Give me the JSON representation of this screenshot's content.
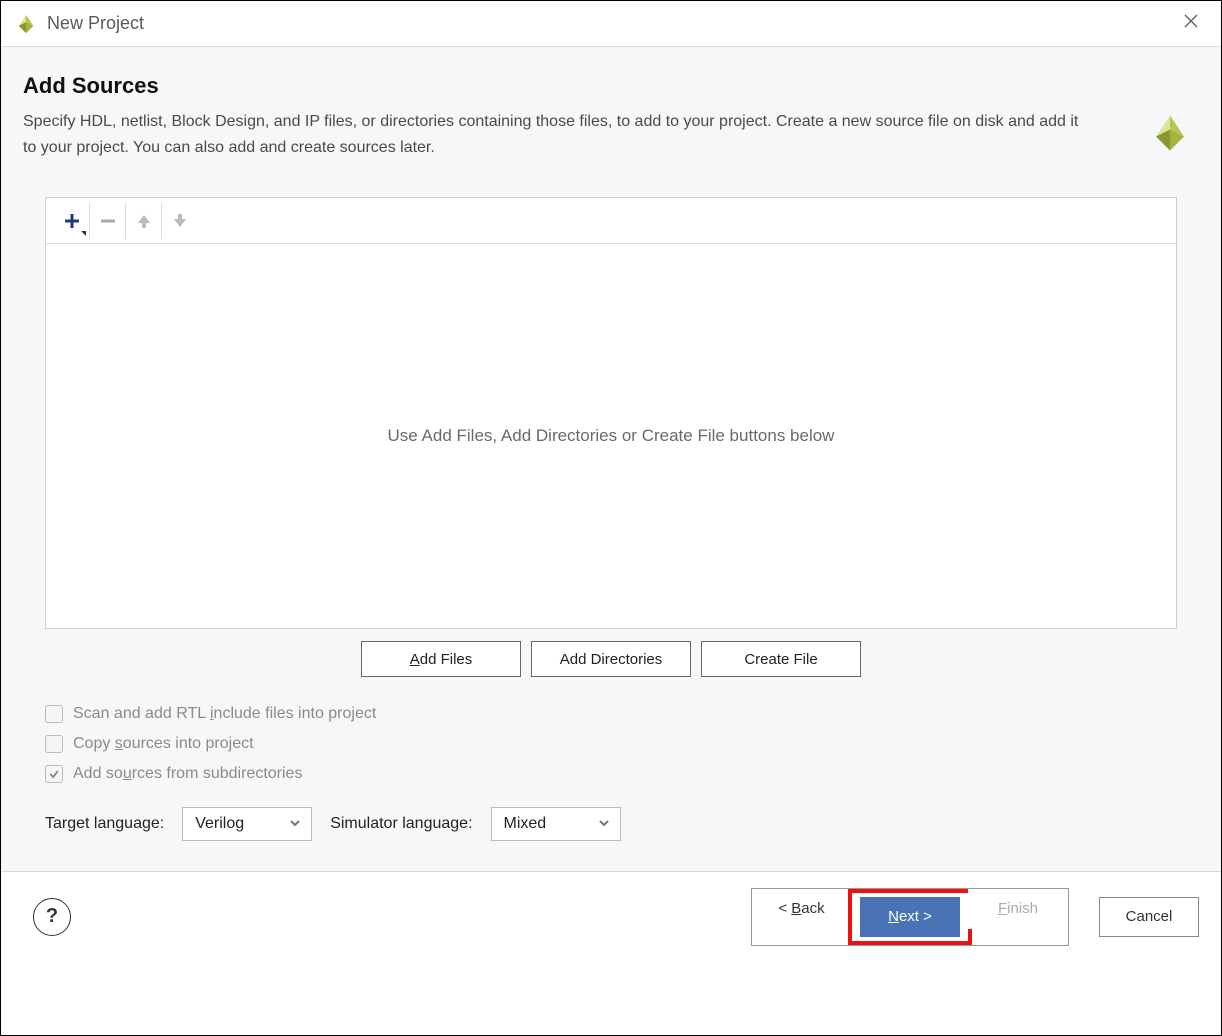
{
  "window": {
    "title": "New Project"
  },
  "header": {
    "heading": "Add Sources",
    "subtitle": "Specify HDL, netlist, Block Design, and IP files, or directories containing those files, to add to your project. Create a new source file on disk and add it to your project. You can also add and create sources later."
  },
  "panel": {
    "empty_text": "Use Add Files, Add Directories or Create File buttons below"
  },
  "toolbar": {
    "add_icon": "plus",
    "remove_icon": "minus",
    "up_icon": "arrow-up",
    "down_icon": "arrow-down"
  },
  "buttons": {
    "add_files_prefix": "A",
    "add_files_rest": "dd Files",
    "add_directories": "Add Directories",
    "create_file": "Create File"
  },
  "options": {
    "scan_prefix": "Scan and add RTL ",
    "scan_ul": "i",
    "scan_rest": "nclude files into project",
    "scan_checked": false,
    "copy_prefix": "Copy ",
    "copy_ul": "s",
    "copy_rest": "ources into project",
    "copy_checked": false,
    "subdirs_prefix": "Add so",
    "subdirs_ul": "u",
    "subdirs_rest": "rces from subdirectories",
    "subdirs_checked": true
  },
  "selects": {
    "target_label": "Target language:",
    "target_value": "Verilog",
    "sim_label": "Simulator language:",
    "sim_value": "Mixed"
  },
  "footer": {
    "help": "?",
    "back_prefix": "< ",
    "back_ul": "B",
    "back_rest": "ack",
    "next_ul": "N",
    "next_rest": "ext >",
    "finish_ul": "F",
    "finish_rest": "inish",
    "cancel": "Cancel"
  }
}
